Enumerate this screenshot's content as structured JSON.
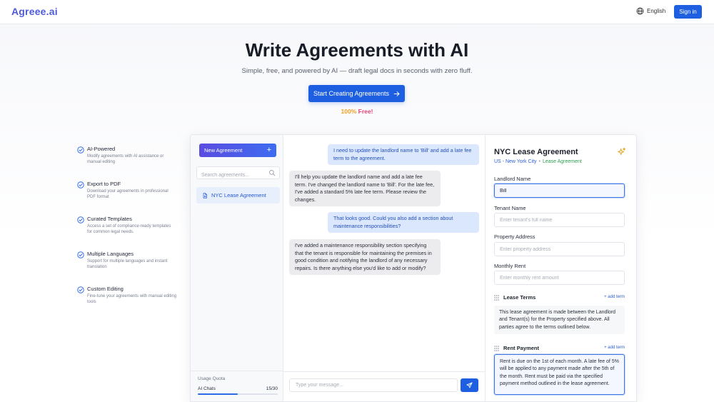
{
  "header": {
    "logo": "Agreee.ai",
    "language": "English",
    "signin": "Sign in"
  },
  "hero": {
    "title": "Write Agreements with AI",
    "subtitle": "Simple, free, and powered by AI — draft legal docs in seconds with zero fluff.",
    "cta": "Start Creating Agreements",
    "free_pct": "100%",
    "free_word": "Free!"
  },
  "features": [
    {
      "title": "AI-Powered",
      "desc": "Modify agreements with AI assistance or manual editing"
    },
    {
      "title": "Export to PDF",
      "desc": "Download your agreements in professional PDF format"
    },
    {
      "title": "Curated Templates",
      "desc": "Access a set of compliance-ready templates for common legal needs."
    },
    {
      "title": "Multiple Languages",
      "desc": "Support for multiple languages and instant translation"
    },
    {
      "title": "Custom Editing",
      "desc": "Fine-tune your agreements with manual editing tools"
    }
  ],
  "sidebar": {
    "new_agreement": "New Agreement",
    "new_icon": "+",
    "search_placeholder": "Search agreements...",
    "items": [
      {
        "label": "NYC Lease Agreement"
      }
    ],
    "quota": {
      "title": "Usage Quota",
      "label": "AI Chats",
      "value": "15/30",
      "used": 15,
      "total": 30
    }
  },
  "chat": {
    "messages": [
      {
        "role": "user",
        "text": "I need to update the landlord name to 'Bill' and add a late fee term to the agreement."
      },
      {
        "role": "bot",
        "text": "I'll help you update the landlord name and add a late fee term. I've changed the landlord name to 'Bill'. For the late fee, I've added a standard 5% late fee term. Please review the changes."
      },
      {
        "role": "user",
        "text": "That looks good. Could you also add a section about maintenance responsibilities?"
      },
      {
        "role": "bot",
        "text": "I've added a maintenance responsibility section specifying that the tenant is responsible for maintaining the premises in good condition and notifying the landlord of any necessary repairs. Is there anything else you'd like to add or modify?"
      }
    ],
    "input_placeholder": "Type your message..."
  },
  "form": {
    "title": "NYC Lease Agreement",
    "country": "US - New York City",
    "dot": "•",
    "type": "Lease Agreement",
    "fields": [
      {
        "label": "Landlord Name",
        "value": "Bill",
        "placeholder": ""
      },
      {
        "label": "Tenant Name",
        "value": "",
        "placeholder": "Enter tenant's full name"
      },
      {
        "label": "Property Address",
        "value": "",
        "placeholder": "Enter property address"
      },
      {
        "label": "Monthly Rent",
        "value": "",
        "placeholder": "Enter monthly rent amount"
      }
    ],
    "sections": [
      {
        "title": "Lease Terms",
        "add": "+ add term",
        "body": "This lease agreement is made between the Landlord and Tenant(s) for the Property specified above. All parties agree to the terms outlined below."
      },
      {
        "title": "Rent Payment",
        "add": "+ add term",
        "body": "Rent is due on the 1st of each month. A late fee of 5% will be applied to any payment made after the 5th of the month. Rent must be paid via the specified payment method outlined in the lease agreement."
      }
    ]
  },
  "colors": {
    "primary": "#1d5fe0",
    "logo": "#4f5bd5",
    "free_pct": "#f0a020",
    "free_word": "#e0457b",
    "success": "#2e9e50"
  }
}
